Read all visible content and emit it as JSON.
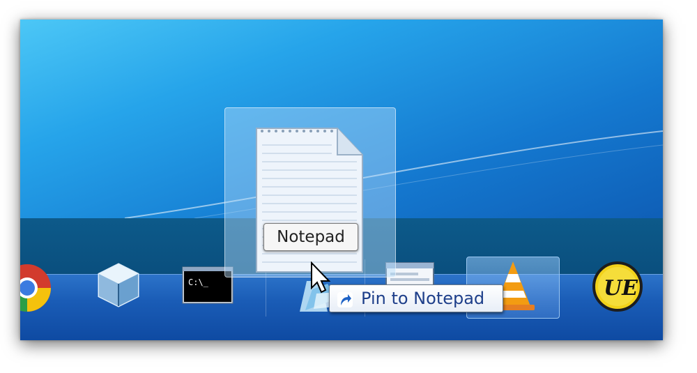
{
  "drag_label": "Notepad",
  "pin_tooltip": "Pin to Notepad",
  "taskbar": {
    "items": [
      {
        "name": "Google Chrome",
        "icon": "chrome-icon"
      },
      {
        "name": "VirtualBox",
        "icon": "virtualbox-icon"
      },
      {
        "name": "Command Prompt",
        "icon": "cmd-icon",
        "text": "C:\\_"
      },
      {
        "name": "Windows Explorer",
        "icon": "explorer-icon"
      },
      {
        "name": "Window",
        "icon": "window-icon"
      },
      {
        "name": "VLC media player",
        "icon": "vlc-icon",
        "active": true
      },
      {
        "name": "UltraEdit",
        "icon": "ultraedit-icon",
        "text": "UE"
      }
    ]
  },
  "colors": {
    "desktop_top": "#4cc7f6",
    "desktop_bottom": "#0f5fb7",
    "taskbar": "#1a5cb6",
    "tooltip_text": "#1e3f8a"
  }
}
